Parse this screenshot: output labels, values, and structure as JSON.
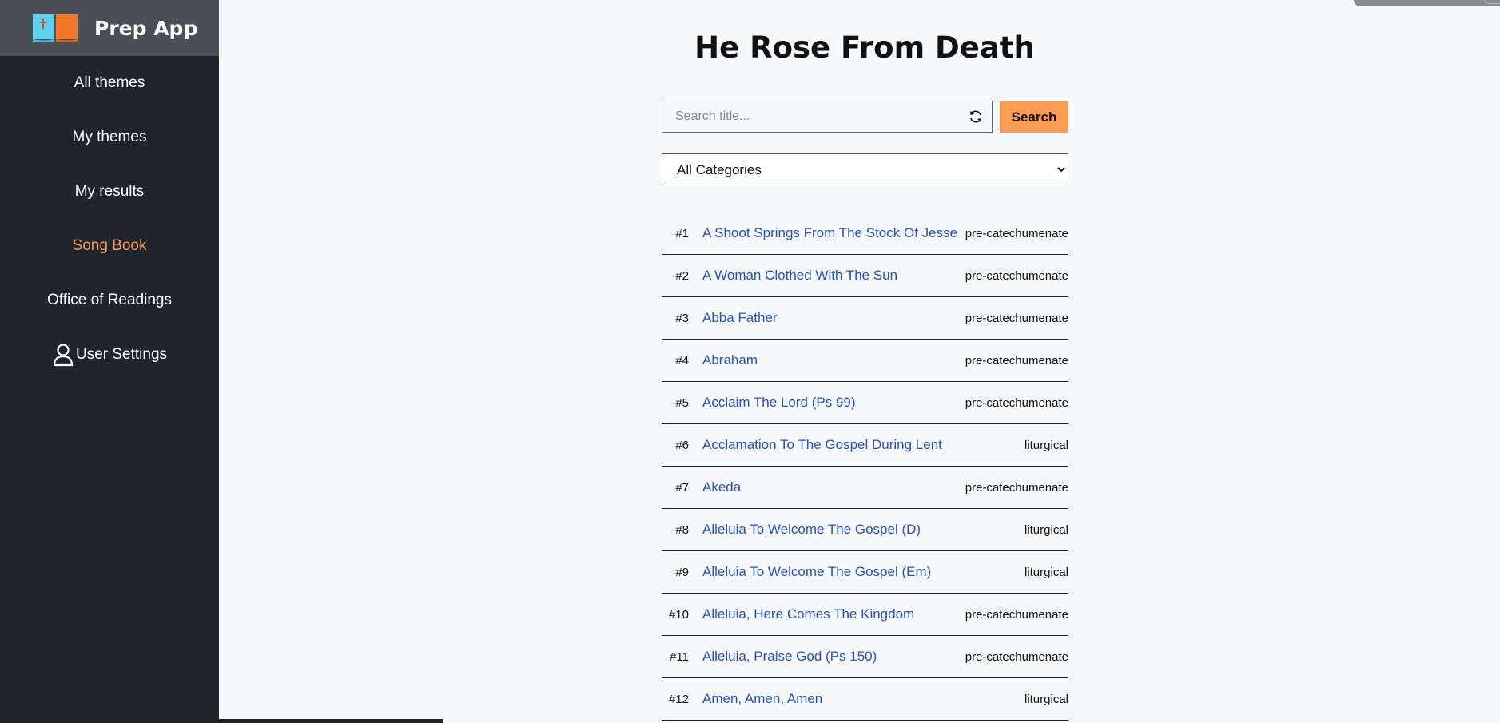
{
  "app": {
    "title": "Prep App"
  },
  "nav": {
    "items": [
      {
        "label": "All themes"
      },
      {
        "label": "My themes"
      },
      {
        "label": "My results"
      },
      {
        "label": "Song Book"
      },
      {
        "label": "Office of Readings"
      },
      {
        "label": "User Settings"
      }
    ],
    "active_index": 3
  },
  "page": {
    "title": "He Rose From Death"
  },
  "search": {
    "placeholder": "Search title...",
    "value": "",
    "button_label": "Search"
  },
  "filter": {
    "selected": "All Categories"
  },
  "songs": [
    {
      "num": "#1",
      "title": "A Shoot Springs From The Stock Of Jesse",
      "category": "pre-catechumenate"
    },
    {
      "num": "#2",
      "title": "A Woman Clothed With The Sun",
      "category": "pre-catechumenate"
    },
    {
      "num": "#3",
      "title": "Abba Father",
      "category": "pre-catechumenate"
    },
    {
      "num": "#4",
      "title": "Abraham",
      "category": "pre-catechumenate"
    },
    {
      "num": "#5",
      "title": "Acclaim The Lord (Ps 99)",
      "category": "pre-catechumenate"
    },
    {
      "num": "#6",
      "title": "Acclamation To The Gospel During Lent",
      "category": "liturgical"
    },
    {
      "num": "#7",
      "title": "Akeda",
      "category": "pre-catechumenate"
    },
    {
      "num": "#8",
      "title": "Alleluia To Welcome The Gospel (D)",
      "category": "liturgical"
    },
    {
      "num": "#9",
      "title": "Alleluia To Welcome The Gospel (Em)",
      "category": "liturgical"
    },
    {
      "num": "#10",
      "title": "Alleluia, Here Comes The Kingdom",
      "category": "pre-catechumenate"
    },
    {
      "num": "#11",
      "title": "Alleluia, Praise God (Ps 150)",
      "category": "pre-catechumenate"
    },
    {
      "num": "#12",
      "title": "Amen, Amen, Amen",
      "category": "liturgical"
    }
  ],
  "colors": {
    "sidebar": "#1f252d",
    "brand_bar": "#4a4f56",
    "accent": "#f59a58",
    "link": "#2350c4",
    "search_button": "#fb9c52"
  },
  "icons": {
    "logo": "open-book-cross-icon",
    "reset": "refresh-icon",
    "user": "user-icon"
  }
}
